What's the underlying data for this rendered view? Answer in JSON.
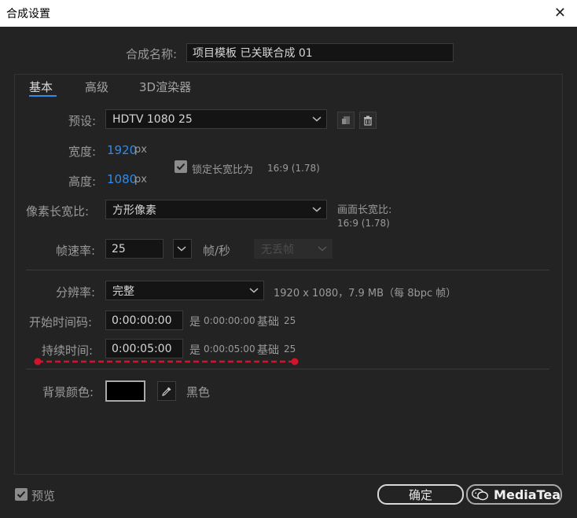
{
  "window": {
    "title": "合成设置"
  },
  "comp_name": {
    "label": "合成名称:",
    "value": "项目模板 已关联合成 01"
  },
  "tabs": [
    {
      "label": "基本",
      "active": true
    },
    {
      "label": "高级",
      "active": false
    },
    {
      "label": "3D渲染器",
      "active": false
    }
  ],
  "preset": {
    "label": "预设:",
    "value": "HDTV 1080 25"
  },
  "width": {
    "label": "宽度:",
    "value": "1920",
    "unit": "px"
  },
  "height": {
    "label": "高度:",
    "value": "1080",
    "unit": "px"
  },
  "lock_aspect": {
    "label": "锁定长宽比为",
    "ratio": "16:9 (1.78)",
    "checked": true
  },
  "pixel_aspect": {
    "label": "像素长宽比:",
    "value": "方形像素"
  },
  "frame_aspect": {
    "label": "画面长宽比:",
    "value": "16:9 (1.78)"
  },
  "frame_rate": {
    "label": "帧速率:",
    "value": "25",
    "unit": "帧/秒",
    "drop_frame": "无丢帧"
  },
  "resolution": {
    "label": "分辨率:",
    "value": "完整",
    "info": "1920 x 1080，7.9 MB（每 8bpc 帧）"
  },
  "start_timecode": {
    "label": "开始时间码:",
    "value": "0:00:00:00",
    "is_label": "是",
    "is_value": "0:00:00:00",
    "base_label": "基础",
    "base_value": "25"
  },
  "duration": {
    "label": "持续时间:",
    "value": "0:00:05:00",
    "is_label": "是",
    "is_value": "0:00:05:00",
    "base_label": "基础",
    "base_value": "25"
  },
  "background": {
    "label": "背景颜色:",
    "color_name": "黑色",
    "swatch": "#000000"
  },
  "preview": {
    "label": "预览",
    "checked": true
  },
  "buttons": {
    "ok": "确定"
  },
  "watermark": {
    "text": "MediaTea"
  },
  "colors": {
    "accent": "#2d8ceb",
    "annotation": "#d0142c"
  }
}
